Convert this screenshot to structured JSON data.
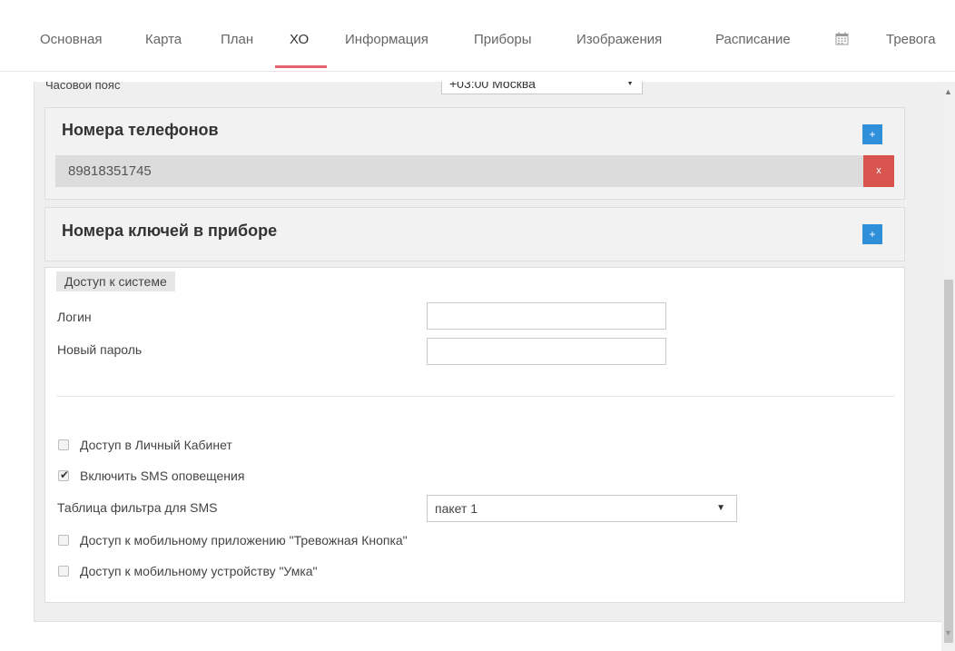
{
  "tabs": [
    {
      "label": "Основная"
    },
    {
      "label": "Карта"
    },
    {
      "label": "План"
    },
    {
      "label": "ХО"
    },
    {
      "label": "Информация"
    },
    {
      "label": "Приборы"
    },
    {
      "label": "Изображения"
    },
    {
      "label": "Расписание"
    },
    {
      "label": "Тревога"
    }
  ],
  "active_tab": "ХО",
  "calendar_icon": "calendar-icon",
  "timezone": {
    "label": "Часовой пояс",
    "value": "+03:00 Москва"
  },
  "phones": {
    "title": "Номера телефонов",
    "add": "+",
    "items": [
      {
        "value": "89818351745",
        "delete": "x"
      }
    ]
  },
  "keys": {
    "title": "Номера ключей в приборе",
    "add": "+"
  },
  "access": {
    "legend": "Доступ к системе",
    "login_label": "Логин",
    "login_value": "",
    "password_label": "Новый пароль",
    "password_value": "",
    "cabinet_label": "Доступ в Личный Кабинет",
    "cabinet_checked": false,
    "sms_label": "Включить SMS оповещения",
    "sms_checked": true,
    "sms_filter_label": "Таблица фильтра для SMS",
    "sms_filter_value": "пакет 1",
    "mobile_app_label": "Доступ к мобильному приложению \"Тревожная Кнопка\"",
    "mobile_app_checked": false,
    "umka_label": "Доступ к мобильному устройству \"Умка\"",
    "umka_checked": false
  },
  "colors": {
    "accent": "#e5636e",
    "primary_button": "#2f8fd8",
    "danger_button": "#d9534f"
  }
}
